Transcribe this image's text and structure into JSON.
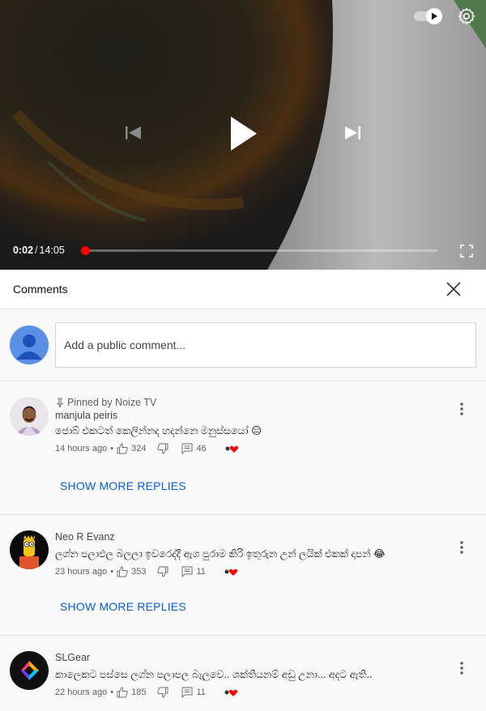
{
  "player": {
    "current_time": "0:02",
    "separator": "/",
    "duration": "14:05",
    "progress_fraction": 0.003
  },
  "comments": {
    "title": "Comments",
    "add_placeholder": "Add a public comment...",
    "threads": [
      {
        "pinned_label": "Pinned by Noize TV",
        "author": "manjula peiris",
        "text": "ජොබ් එකටත් කෙලින්නද හදන්නෙ මනුස්සයෝ 😑",
        "time": "14 hours ago",
        "likes": "324",
        "replies": "46",
        "show_more": "SHOW MORE REPLIES"
      },
      {
        "pinned_label": "",
        "author": "Neo R Evanz",
        "text": "ලග්න පලාඵල බලලා ඉවරෙද්දී ඇග පුරාම කිරි ඉතුරුන උන් ලයික් එකක් දාපන් 😂",
        "time": "23 hours ago",
        "likes": "353",
        "replies": "11",
        "show_more": "SHOW MORE REPLIES"
      },
      {
        "pinned_label": "",
        "author": "SLGear",
        "text": "කාලෙකට පස්සෙ ලග්න පලාපල බැලුවෙ..  ශක්තියනම් අඩු උනා... අදට ඇති..",
        "time": "22 hours ago",
        "likes": "185",
        "replies": "11",
        "show_more": ""
      }
    ]
  },
  "icons": {
    "autoplay": "autoplay-toggle-icon",
    "settings": "gear-icon",
    "previous": "skip-previous-icon",
    "play": "play-icon",
    "next": "skip-next-icon",
    "fullscreen": "fullscreen-icon",
    "close": "close-icon",
    "like": "thumbs-up-icon",
    "dislike": "thumbs-down-icon",
    "reply": "reply-icon",
    "heart": "creator-heart-icon",
    "pin": "pin-icon",
    "menu": "more-vert-icon"
  },
  "colors": {
    "accent_red": "#ff0000",
    "link_blue": "#065fd4",
    "avatar_blue": "#5b8fe6"
  }
}
